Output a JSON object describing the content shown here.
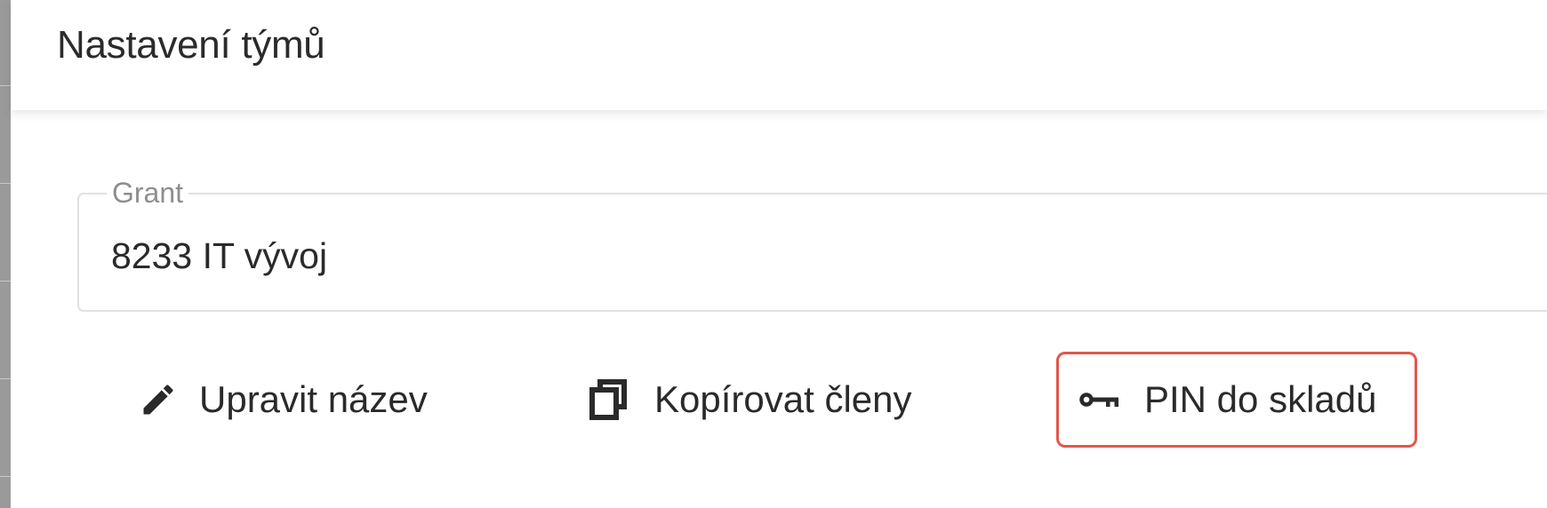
{
  "dialog": {
    "title": "Nastavení týmů"
  },
  "grant_field": {
    "label": "Grant",
    "value": "8233 IT vývoj"
  },
  "actions": [
    {
      "label": "Upravit název",
      "icon": "pencil-icon"
    },
    {
      "label": "Kopírovat členy",
      "icon": "copy-icon"
    },
    {
      "label": "PIN do skladů",
      "icon": "key-icon",
      "highlighted": true
    }
  ],
  "colors": {
    "highlight_border": "#e2574c",
    "text": "#2a2a2a",
    "legend": "#8e8e8e"
  }
}
